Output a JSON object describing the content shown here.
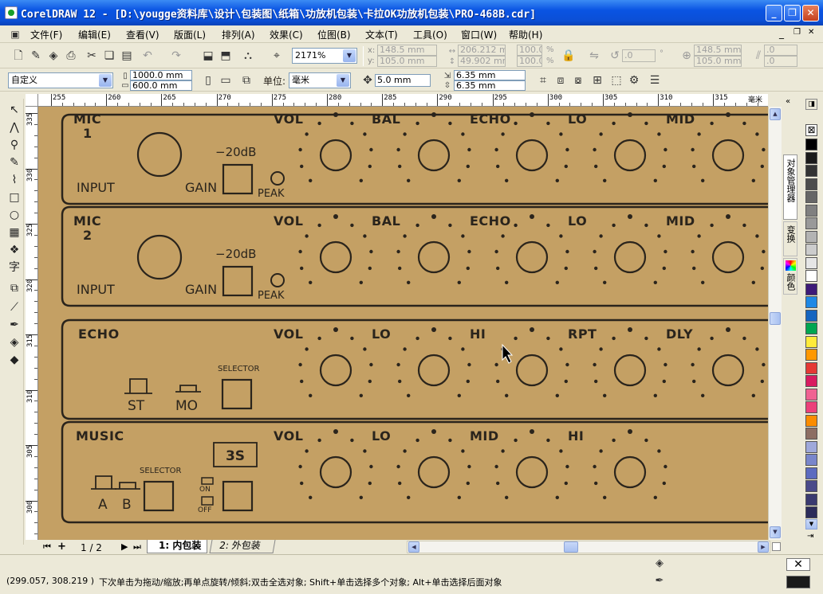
{
  "title": "CorelDRAW 12 - [D:\\yougge资料库\\设计\\包装图\\纸箱\\功放机包装\\卡拉OK功放机包装\\PRO-468B.cdr]",
  "window_buttons": {
    "min": "_",
    "max": "❐",
    "close": "✕"
  },
  "menu": [
    "文件(F)",
    "编辑(E)",
    "查看(V)",
    "版面(L)",
    "排列(A)",
    "效果(C)",
    "位图(B)",
    "文本(T)",
    "工具(O)",
    "窗口(W)",
    "帮助(H)"
  ],
  "doc_controls": {
    "min": "_",
    "restore": "❐",
    "close": "✕"
  },
  "toolbar1": {
    "zoom": "2171%",
    "x": "148.5 mm",
    "y": "105.0 mm",
    "w": "206.212 mm",
    "h": "49.902 mm",
    "sx": "100.0",
    "sy": "100.0",
    "pct": "%",
    "angle": ".0",
    "deg": "°",
    "x2": "148.5 mm",
    "y2": "105.0 mm",
    "skew1": ".0",
    "skew2": ".0",
    "x_lbl": "x:",
    "y_lbl": "y:"
  },
  "toolbar2": {
    "paper": "自定义",
    "pw": "1000.0 mm",
    "ph": "600.0 mm",
    "unit_label": "单位:",
    "unit": "毫米",
    "nudge": "5.0 mm",
    "dup_x": "6.35 mm",
    "dup_y": "6.35 mm"
  },
  "hruler_ticks": [
    "255",
    "260",
    "265",
    "270",
    "275",
    "280",
    "285",
    "290",
    "295",
    "300",
    "305",
    "310",
    "315"
  ],
  "hruler_unit": "毫米",
  "vruler_ticks": [
    "335",
    "330",
    "325",
    "320",
    "315",
    "310",
    "305",
    "300"
  ],
  "design": {
    "mic1": {
      "title": "MIC",
      "num": "1",
      "input": "INPUT",
      "gain": "GAIN",
      "db": "−20dB",
      "peak": "PEAK"
    },
    "mic2": {
      "title": "MIC",
      "num": "2",
      "input": "INPUT",
      "gain": "GAIN",
      "db": "−20dB",
      "peak": "PEAK"
    },
    "mic_knobs": [
      "VOL",
      "BAL",
      "ECHO",
      "LO",
      "MID"
    ],
    "echo": {
      "title": "ECHO",
      "selector": "SELECTOR",
      "st": "ST",
      "mo": "MO"
    },
    "echo_knobs": [
      "VOL",
      "LO",
      "HI",
      "RPT",
      "DLY"
    ],
    "music": {
      "title": "MUSIC",
      "selector": "SELECTOR",
      "a": "A",
      "b": "B",
      "on": "ON",
      "off": "OFF",
      "logo": "3S"
    },
    "music_knobs": [
      "VOL",
      "LO",
      "MID",
      "HI"
    ]
  },
  "page_nav": {
    "count": "1 / 2",
    "tab1": "1: 内包装",
    "tab2": "2: 外包装"
  },
  "docker_tabs": [
    "对象管理器",
    "变换",
    "颜色"
  ],
  "palette_colors": [
    "#ffffff",
    "#000000",
    "#1a1a1a",
    "#333333",
    "#4d4d4d",
    "#666666",
    "#808080",
    "#999999",
    "#b3b3b3",
    "#cccccc",
    "#e6e6e6",
    "#ffffff",
    "#3d1a78",
    "#1e88e5",
    "#1565c0",
    "#00a651",
    "#ffeb3b",
    "#ff9800",
    "#e53935",
    "#d81b60",
    "#f06292",
    "#ec407a",
    "#fb8c00",
    "#8d6e63",
    "#9fa8da",
    "#7986cb",
    "#5c6bc0",
    "#4a4a8a",
    "#3a3a70",
    "#2c2c5a"
  ],
  "status": {
    "coords": "(299.057, 308.219 )",
    "hint": "下次单击为拖动/缩放;再单点旋转/倾斜;双击全选对象; Shift+单击选择多个对象; Alt+单击选择后面对象"
  },
  "colors": {
    "panel_fill": "#c4a064",
    "ink": "#2a241c",
    "title_blue": "#0a54e3"
  }
}
